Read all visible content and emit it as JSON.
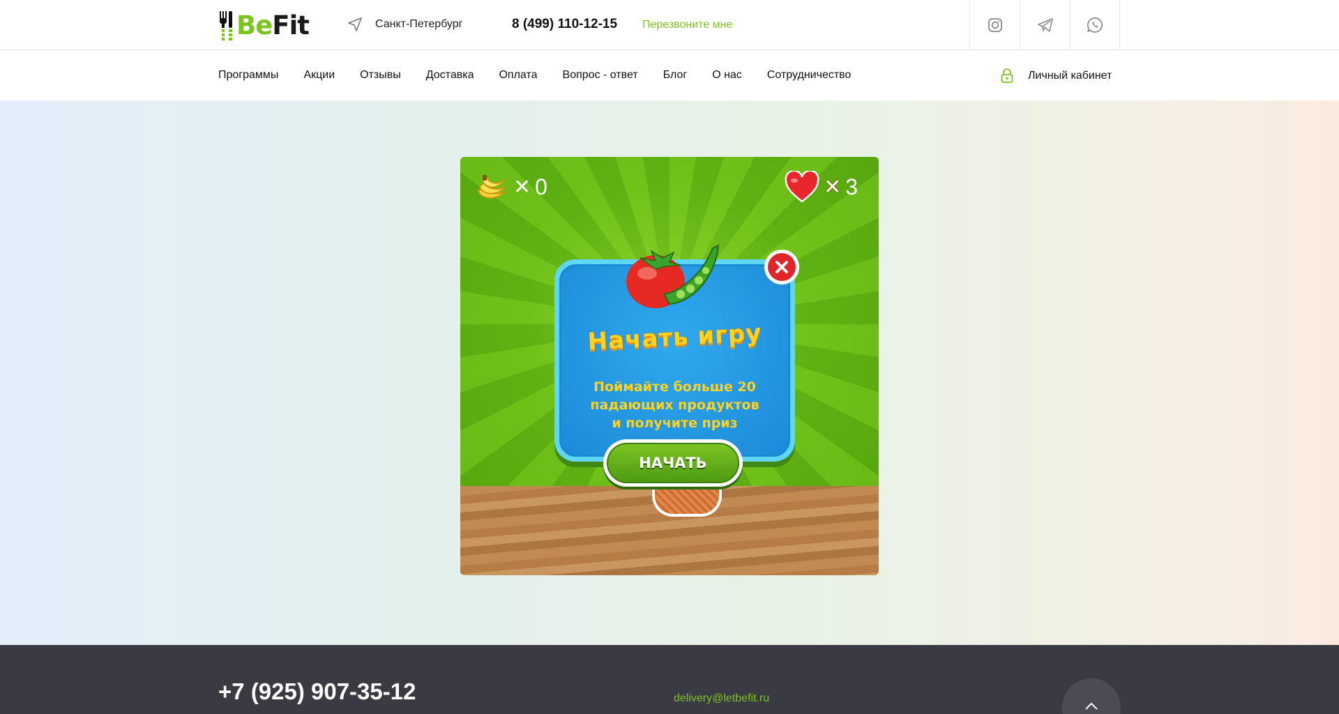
{
  "header": {
    "logo": {
      "part1": "Be",
      "part2": "Fit"
    },
    "city": "Санкт-Петербург",
    "phone": "8 (499) 110-12-15",
    "callback_label": "Перезвоните мне",
    "socials": [
      "instagram-icon",
      "telegram-icon",
      "whatsapp-icon"
    ]
  },
  "nav": {
    "items": [
      "Программы",
      "Акции",
      "Отзывы",
      "Доставка",
      "Оплата",
      "Вопрос - ответ",
      "Блог",
      "О нас",
      "Сотрудничество"
    ],
    "cabinet_label": "Личный кабинет"
  },
  "game": {
    "score_value": "0",
    "lives_value": "3",
    "title": "Начать игру",
    "description_lines": [
      "Поймайте больше 20",
      "падающих продуктов",
      "и получите приз"
    ],
    "start_label": "НАЧАТЬ"
  },
  "footer": {
    "phone": "+7 (925) 907-35-12",
    "email": "delivery@letbefit.ru"
  },
  "colors": {
    "accent": "#7cc41f",
    "footer_bg": "#3a3a42",
    "game_title": "#ffd21f",
    "close_red": "#e2252b"
  }
}
